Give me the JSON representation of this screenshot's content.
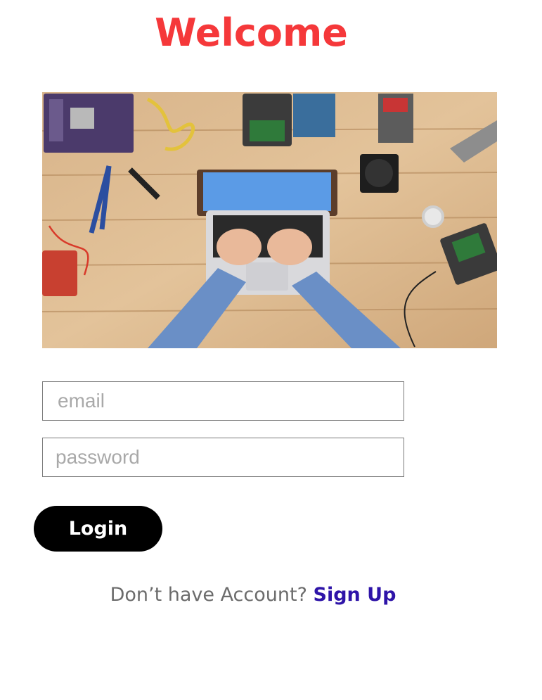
{
  "header": {
    "title": "Welcome"
  },
  "hero": {
    "icon": "workspace-photo"
  },
  "form": {
    "email_placeholder": "email",
    "password_placeholder": "password",
    "login_label": "Login"
  },
  "footer": {
    "prompt": "Don’t have Account?",
    "signup_label": "Sign Up"
  },
  "colors": {
    "title": "#f5383a",
    "button_bg": "#000000",
    "link": "#2e14a8"
  }
}
